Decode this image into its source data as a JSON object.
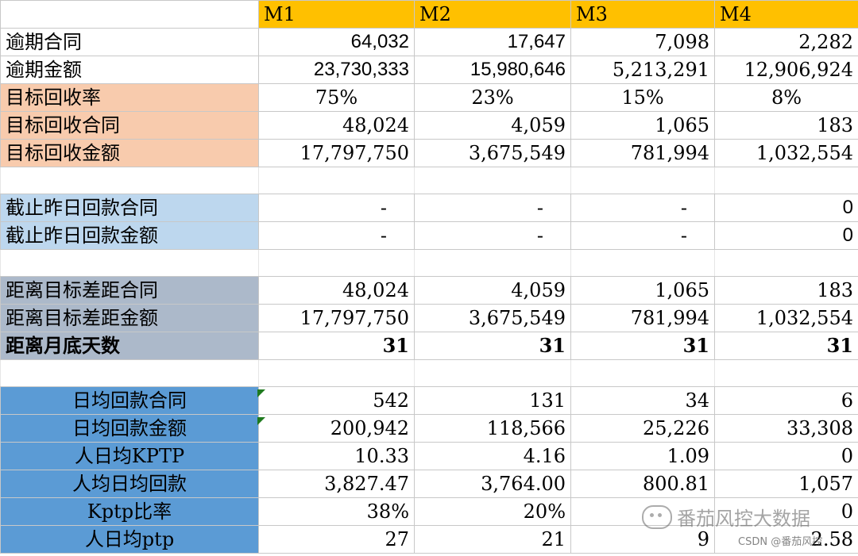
{
  "header": {
    "cols": [
      "M1",
      "M2",
      "M3",
      "M4"
    ]
  },
  "rows": [
    {
      "label": "逾期合同",
      "values": [
        "64,032",
        "17,647",
        "7,098",
        "2,282"
      ]
    },
    {
      "label": "逾期金额",
      "values": [
        "23,730,333",
        "15,980,646",
        "5,213,291",
        "12,906,924"
      ]
    },
    {
      "label": "目标回收率",
      "values": [
        "75%",
        "23%",
        "15%",
        "8%"
      ]
    },
    {
      "label": "目标回收合同",
      "values": [
        "48,024",
        "4,059",
        "1,065",
        "183"
      ]
    },
    {
      "label": "目标回收金额",
      "values": [
        "17,797,750",
        "3,675,549",
        "781,994",
        "1,032,554"
      ]
    },
    {
      "label": "截止昨日回款合同",
      "values": [
        "-",
        "-",
        "-",
        "0"
      ]
    },
    {
      "label": "截止昨日回款金额",
      "values": [
        "-",
        "-",
        "-",
        "0"
      ]
    },
    {
      "label": "距离目标差距合同",
      "values": [
        "48,024",
        "4,059",
        "1,065",
        "183"
      ]
    },
    {
      "label": "距离目标差距金额",
      "values": [
        "17,797,750",
        "3,675,549",
        "781,994",
        "1,032,554"
      ]
    },
    {
      "label": "距离月底天数",
      "values": [
        "31",
        "31",
        "31",
        "31"
      ]
    },
    {
      "label": "日均回款合同",
      "values": [
        "542",
        "131",
        "34",
        "6"
      ]
    },
    {
      "label": "日均回款金额",
      "values": [
        "200,942",
        "118,566",
        "25,226",
        "33,308"
      ]
    },
    {
      "label": "人日均KPTP",
      "values": [
        "10.33",
        "4.16",
        "1.09",
        "0"
      ]
    },
    {
      "label": "人均日均回款",
      "values": [
        "3,827.47",
        "3,764.00",
        "800.81",
        "1,057"
      ]
    },
    {
      "label": "Kptp比率",
      "values": [
        "38%",
        "20%",
        "",
        "0"
      ]
    },
    {
      "label": "人日均ptp",
      "values": [
        "27",
        "21",
        "9",
        "2.58"
      ]
    }
  ],
  "watermark": {
    "text": "番茄风控大数据",
    "icon": "wechat-icon"
  },
  "csdn": "CSDN @番茄风控",
  "colors": {
    "header": "#ffc000",
    "peach": "#f8cbad",
    "light_blue": "#bdd7ee",
    "gray_blue": "#acb9ca",
    "blue": "#5b9bd5"
  }
}
